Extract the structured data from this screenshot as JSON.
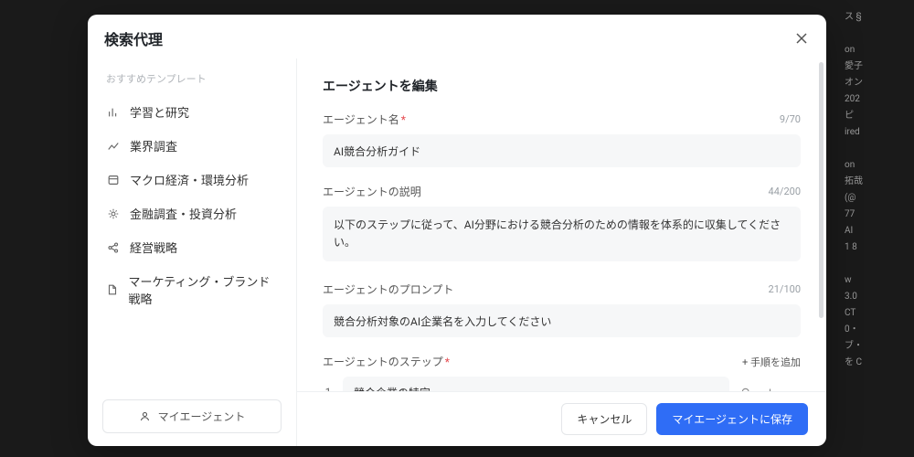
{
  "modal": {
    "title": "検索代理",
    "sidebar": {
      "header": "おすすめテンプレート",
      "items": [
        {
          "label": "学習と研究"
        },
        {
          "label": "業界調査"
        },
        {
          "label": "マクロ経済・環境分析"
        },
        {
          "label": "金融調査・投資分析"
        },
        {
          "label": "経営戦略"
        },
        {
          "label": "マーケティング・ブランド戦略"
        }
      ],
      "my_agent_label": "マイエージェント"
    },
    "form": {
      "heading": "エージェントを編集",
      "name": {
        "label": "エージェント名",
        "value": "AI競合分析ガイド",
        "counter": "9/70"
      },
      "description": {
        "label": "エージェントの説明",
        "value": "以下のステップに従って、AI分野における競合分析のための情報を体系的に収集してください。",
        "counter": "44/200"
      },
      "prompt": {
        "label": "エージェントのプロンプト",
        "value": "競合分析対象のAI企業名を入力してください",
        "counter": "21/100"
      },
      "steps": {
        "label": "エージェントのステップ",
        "add_label": "+ 手順を追加",
        "items": [
          {
            "num": "1",
            "value": "競合企業の特定"
          }
        ]
      }
    },
    "footer": {
      "cancel": "キャンセル",
      "save": "マイエージェントに保存"
    }
  }
}
